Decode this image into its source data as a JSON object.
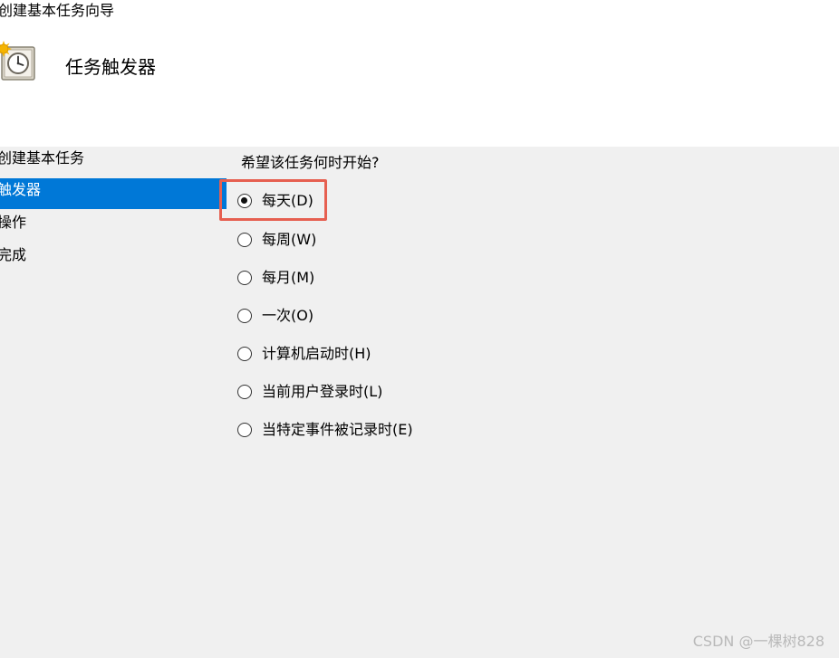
{
  "window": {
    "title": "创建基本任务向导"
  },
  "header": {
    "heading": "任务触发器",
    "icon": "clock-icon"
  },
  "nav": {
    "items": [
      {
        "label": "创建基本任务",
        "selected": false
      },
      {
        "label": "触发器",
        "selected": true
      },
      {
        "label": "操作",
        "selected": false
      },
      {
        "label": "完成",
        "selected": false
      }
    ],
    "selected_color": "#0078d7"
  },
  "main": {
    "question": "希望该任务何时开始?",
    "options": [
      {
        "label": "每天(D)",
        "checked": true
      },
      {
        "label": "每周(W)",
        "checked": false
      },
      {
        "label": "每月(M)",
        "checked": false
      },
      {
        "label": "一次(O)",
        "checked": false
      },
      {
        "label": "计算机启动时(H)",
        "checked": false
      },
      {
        "label": "当前用户登录时(L)",
        "checked": false
      },
      {
        "label": "当特定事件被记录时(E)",
        "checked": false
      }
    ]
  },
  "annotation": {
    "highlight_color": "#e65f50"
  },
  "watermark": "CSDN @一棵树828"
}
